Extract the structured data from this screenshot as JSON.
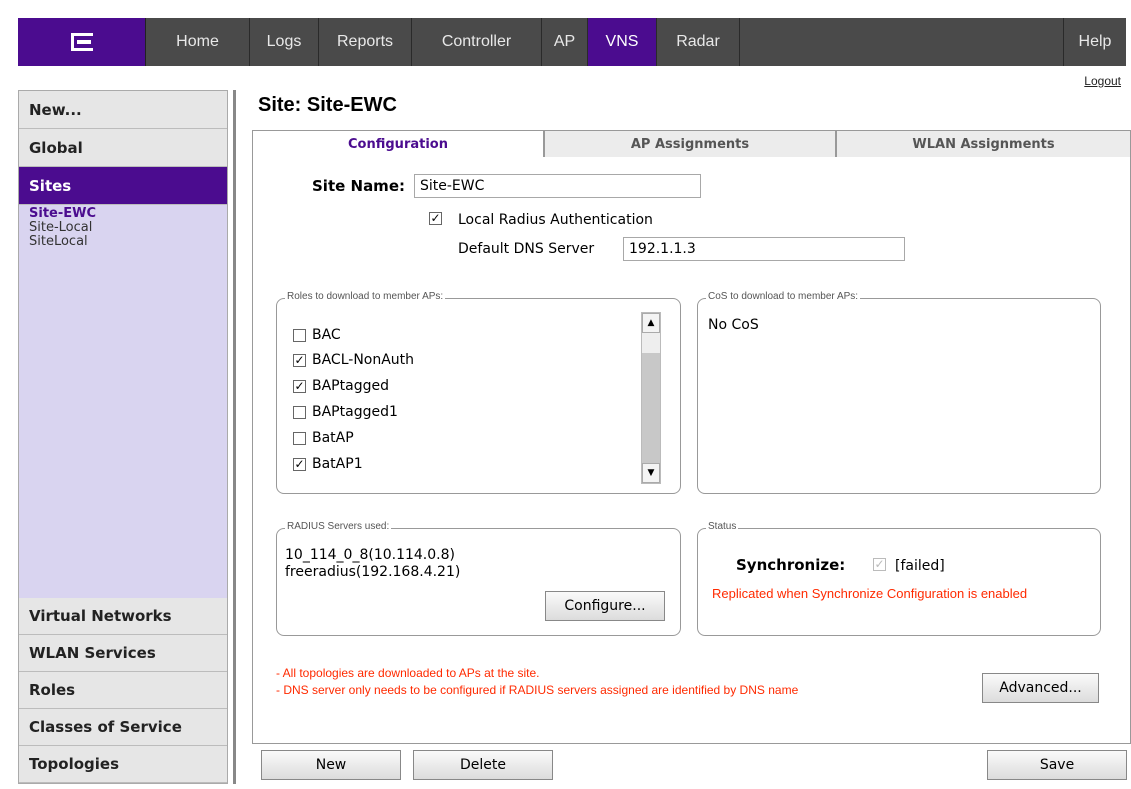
{
  "nav": {
    "tabs": [
      "Home",
      "Logs",
      "Reports",
      "Controller",
      "AP",
      "VNS",
      "Radar"
    ],
    "active": "VNS",
    "help": "Help",
    "logout": "Logout"
  },
  "sidebar": {
    "new": "New...",
    "global": "Global",
    "sites": "Sites",
    "site_items": [
      "Site-EWC",
      "Site-Local",
      "SiteLocal"
    ],
    "bottom": [
      "Virtual Networks",
      "WLAN Services",
      "Roles",
      "Classes of Service",
      "Topologies"
    ]
  },
  "page_title": "Site: Site-EWC",
  "content_tabs": [
    "Configuration",
    "AP Assignments",
    "WLAN Assignments"
  ],
  "form": {
    "site_name_label": "Site Name:",
    "site_name_value": "Site-EWC",
    "local_radius_label": "Local Radius Authentication",
    "local_radius_checked": true,
    "dns_label": "Default DNS Server",
    "dns_value": "192.1.1.3"
  },
  "roles_group": {
    "legend": "Roles to download to member APs:",
    "items": [
      {
        "label": "BAC",
        "checked": false
      },
      {
        "label": "BACL-NonAuth",
        "checked": true
      },
      {
        "label": "BAPtagged",
        "checked": true
      },
      {
        "label": "BAPtagged1",
        "checked": false
      },
      {
        "label": "BatAP",
        "checked": false
      },
      {
        "label": "BatAP1",
        "checked": true
      }
    ]
  },
  "cos_group": {
    "legend": "CoS to download to member APs:",
    "value": "No CoS"
  },
  "radius_group": {
    "legend": "RADIUS Servers used:",
    "servers": [
      "10_114_0_8(10.114.0.8)",
      "freeradius(192.168.4.21)"
    ],
    "configure": "Configure..."
  },
  "status_group": {
    "legend": "Status",
    "sync_label": "Synchronize:",
    "sync_state": "[failed]",
    "note": "Replicated when Synchronize Configuration is enabled"
  },
  "notes": [
    "- All topologies are downloaded to APs at the site.",
    "- DNS server only needs to be configured if RADIUS servers assigned are identified by DNS name"
  ],
  "buttons": {
    "advanced": "Advanced...",
    "new": "New",
    "delete": "Delete",
    "save": "Save"
  },
  "colors": {
    "brand": "#4b0c8f",
    "nav_bg": "#4a4a4a",
    "sidebar_bg": "#d9d4f0",
    "warning": "#ff2a00"
  }
}
